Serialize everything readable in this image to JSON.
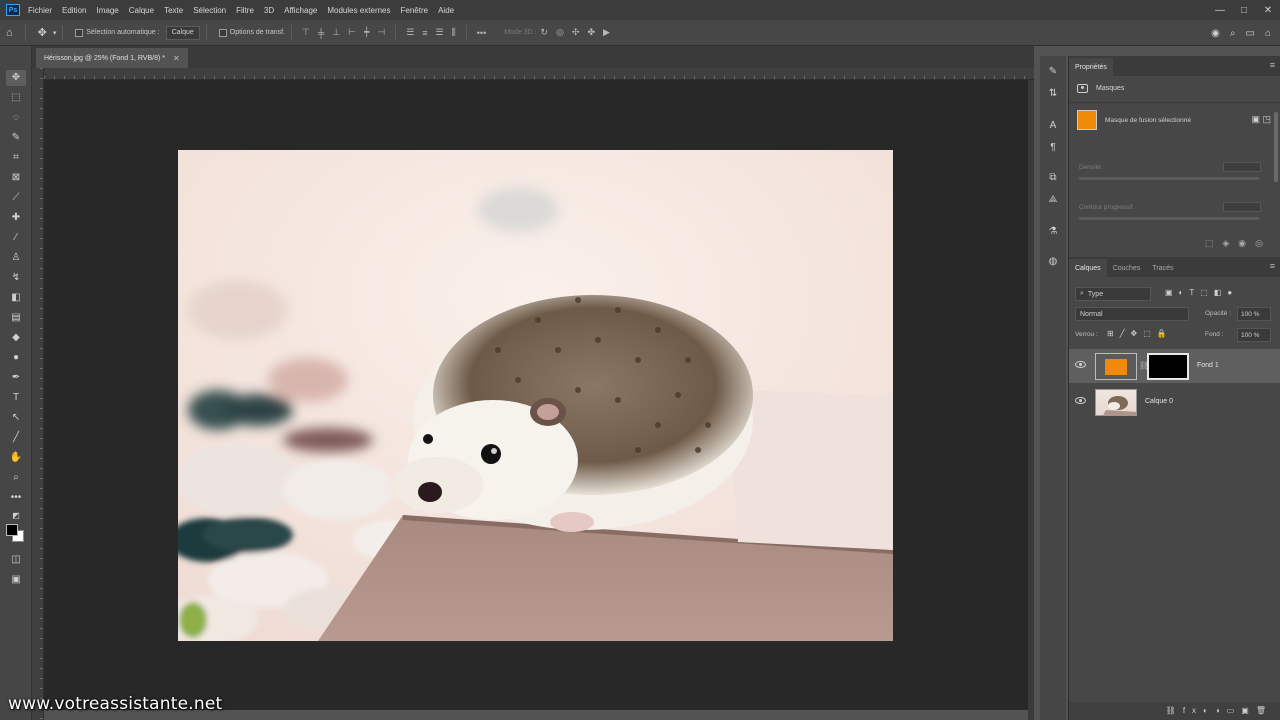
{
  "app": {
    "logo": "Ps"
  },
  "menu": [
    "Fichier",
    "Edition",
    "Image",
    "Calque",
    "Texte",
    "Sélection",
    "Filtre",
    "3D",
    "Affichage",
    "Modules externes",
    "Fenêtre",
    "Aide"
  ],
  "window_controls": {
    "minimize": "—",
    "maximize": "□",
    "close": "✕"
  },
  "options_bar": {
    "auto_select_label": "Sélection automatique :",
    "auto_select_target": "Calque",
    "transform_options_label": "Options de transf.",
    "mode_3d_label": "Mode 3D :"
  },
  "document": {
    "tab_title": "Hérisson.jpg @ 25% (Fond 1, RVB/8) *",
    "close_glyph": "✕"
  },
  "watermark": "www.votreassistante.net",
  "properties_panel": {
    "tab_label": "Propriétés",
    "header_label": "Masques",
    "mask_label": "Masque de fusion sélectionné",
    "mask_color": "#f08a0a",
    "density_label": "Densité :",
    "feather_label": "Contour progressif :"
  },
  "layers_panel": {
    "tabs": [
      "Calques",
      "Couches",
      "Tracés"
    ],
    "filter_placeholder": "Type",
    "blend_mode": "Normal",
    "opacity_label": "Opacité :",
    "opacity_value": "100 %",
    "lock_label": "Verrou :",
    "fill_label": "Fond :",
    "fill_value": "100 %",
    "layers": [
      {
        "name": "Fond 1",
        "selected": true,
        "thumb_color": "#f08a0a",
        "mask_color": "#000000"
      },
      {
        "name": "Calque 0",
        "selected": false
      }
    ]
  },
  "colors": {
    "accent_orange": "#f08a0a",
    "canvas_bg": "#282828",
    "panel_bg": "#474747",
    "foreground_swatch": "#000000",
    "background_swatch": "#ffffff"
  }
}
